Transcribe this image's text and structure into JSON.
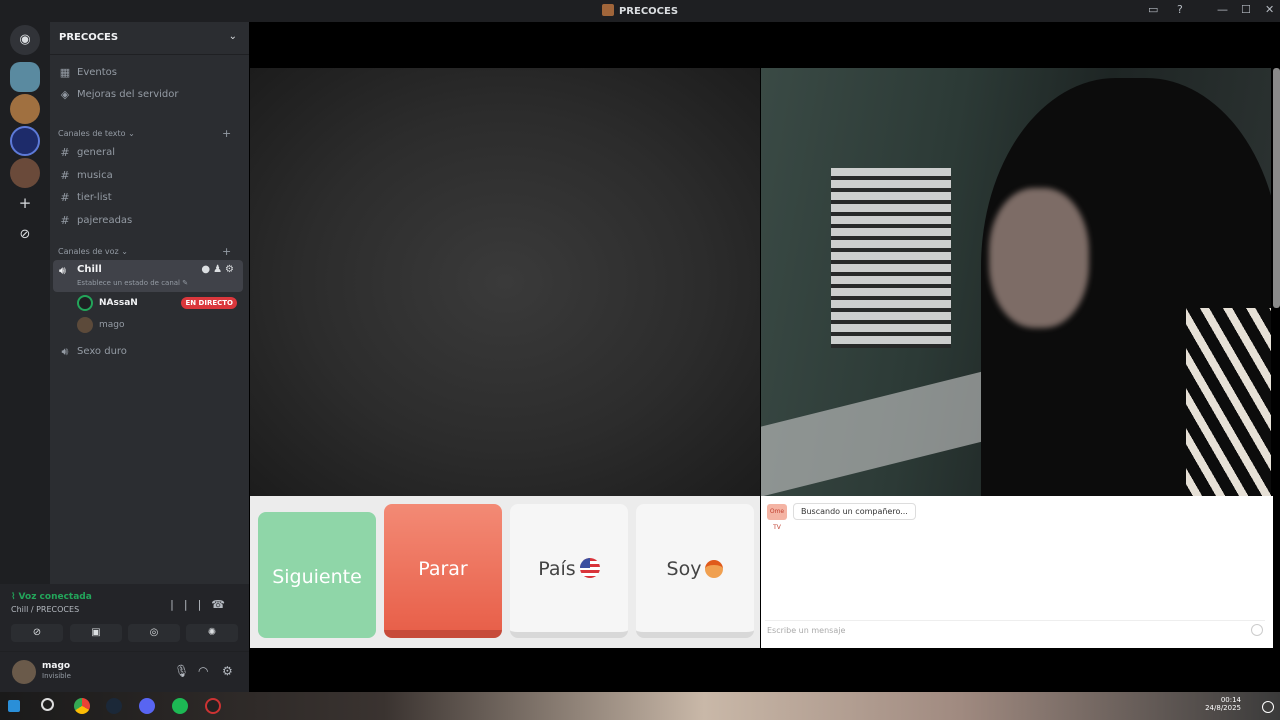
{
  "window": {
    "title": "PRECOCES"
  },
  "server": {
    "name": "PRECOCES",
    "top_items": [
      {
        "icon": "calendar-icon",
        "label": "Eventos"
      },
      {
        "icon": "boost-icon",
        "label": "Mejoras del servidor"
      }
    ],
    "text_category": "Canales de texto",
    "text_channels": [
      "general",
      "musica",
      "tier-list",
      "pajereadas"
    ],
    "voice_category": "Canales de voz",
    "voice_channels": [
      {
        "name": "Chill",
        "status_hint": "Establece un estado de canal",
        "active": true
      },
      {
        "name": "Sexo duro"
      }
    ],
    "voice_users": [
      {
        "name": "NAssaN",
        "badge": "EN DIRECTO"
      },
      {
        "name": "mago"
      }
    ]
  },
  "voice_panel": {
    "status": "Voz conectada",
    "path": "Chill / PRECOCES"
  },
  "user": {
    "name": "mago",
    "status": "Invisible"
  },
  "controls": {
    "next": "Siguiente",
    "stop": "Parar",
    "country": "País",
    "soy": "Soy"
  },
  "chat": {
    "logo": "Ome TV",
    "message": "Buscando un compañero...",
    "placeholder": "Escribe un mensaje"
  },
  "tray": {
    "time": "00:14",
    "date": "24/8/2025"
  },
  "colors": {
    "connected": "#23a55a",
    "live": "#da373c",
    "next": "#8fd6a8",
    "stop": "#e8604a"
  }
}
